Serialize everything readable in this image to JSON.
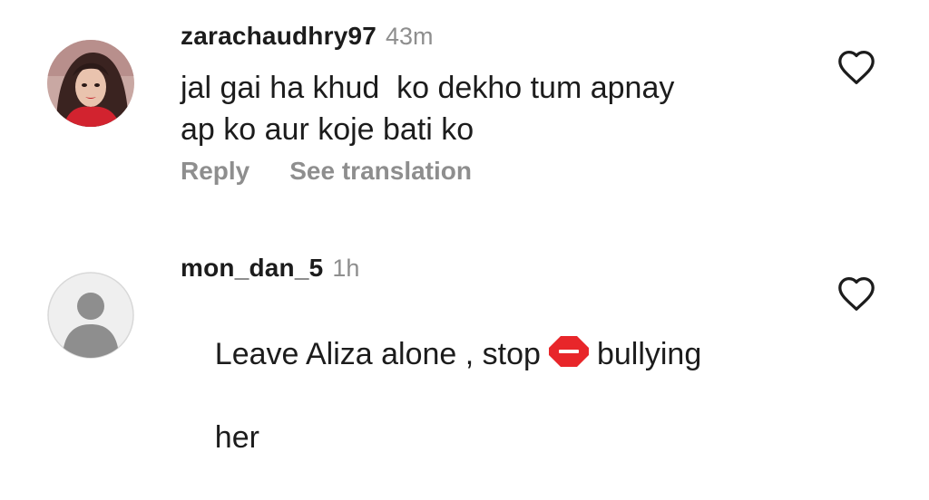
{
  "comments": [
    {
      "username": "zarachaudhry97",
      "time": "43m",
      "text": "jal gai ha khud  ko dekho tum apnay\nap ko aur koje bati ko",
      "actions": {
        "reply": "Reply",
        "translate": "See translation"
      },
      "avatar": "profile-photo"
    },
    {
      "username": "mon_dan_5",
      "time": "1h",
      "text_before": "Leave Aliza alone , stop",
      "emoji": "stop-sign-emoji",
      "text_after": "bullying",
      "text_line2": "her",
      "avatar": "default-avatar"
    }
  ],
  "colors": {
    "meta_gray": "#8e8e8e",
    "text": "#1c1c1c",
    "stop_red": "#e8262a"
  }
}
